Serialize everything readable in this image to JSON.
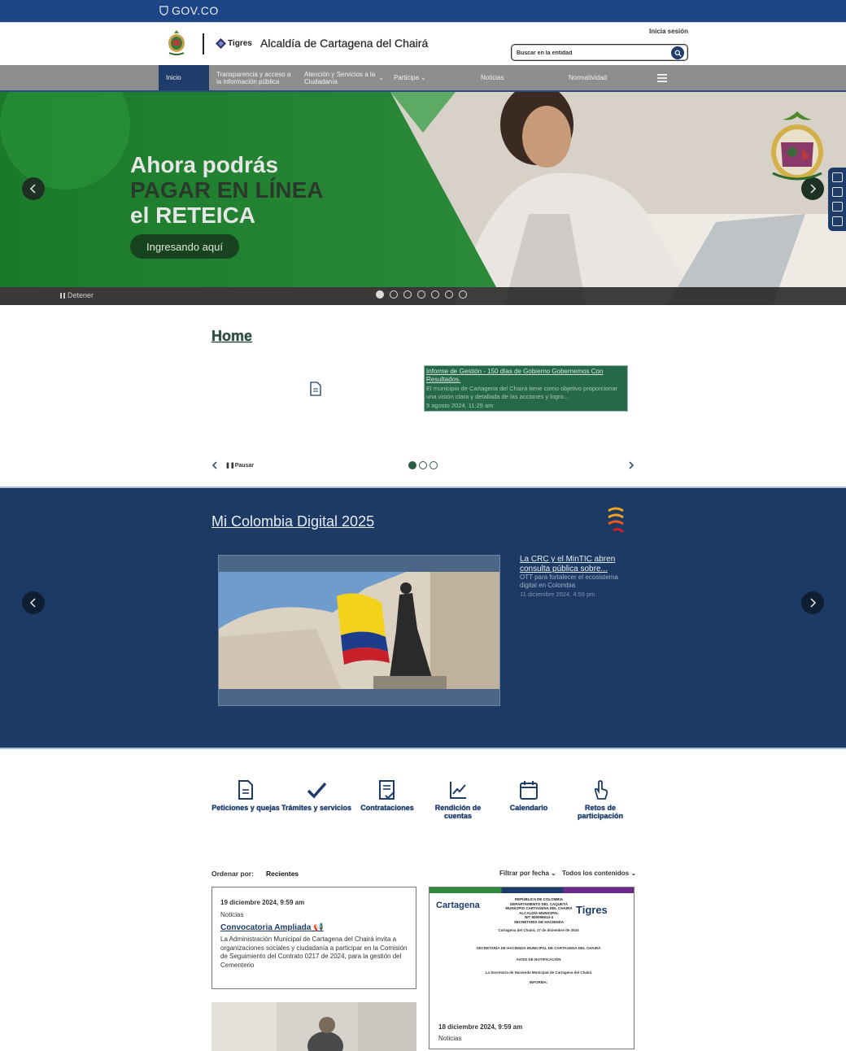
{
  "gov_bar": {
    "label": "GOV.CO"
  },
  "header": {
    "tigres_label": "Tigres",
    "site_name": "Alcaldía de Cartagena del Chairá",
    "login_label": "Inicia sesión",
    "search_placeholder": "Buscar en la entidad"
  },
  "nav": {
    "items": [
      {
        "label": "Inicio"
      },
      {
        "label": "Transparencia y acceso a la información pública"
      },
      {
        "label": "Atención y Servicios a la Ciudadanía"
      },
      {
        "label": "Participa"
      },
      {
        "label": "Noticias"
      },
      {
        "label": "Normatividad"
      }
    ]
  },
  "hero": {
    "line1": "Ahora podrás",
    "line2": "PAGAR EN LÍNEA",
    "line3": "el RETEICA",
    "cta_label": "Ingresando aquí",
    "stop_label": "Detener",
    "slide_count": 7,
    "active_slide": 1
  },
  "home": {
    "title": "Home",
    "news": {
      "title": "Informe de Gestión - 150 días de Gobierno Gobernemos Con Resultados.",
      "excerpt": "El municipio de Cartagena del Chairá tiene como objetivo proporcionar una visión clara y detallada de las acciones y logro...",
      "date": "9 agosto 2024, 11:29 am"
    },
    "pause_label": "Pausar",
    "slide_count": 3,
    "active_slide": 1
  },
  "digital": {
    "title": "Mi Colombia Digital 2025",
    "news_title": "La CRC y el MinTIC abren consulta pública sobre...",
    "news_excerpt": "OTT para fortalecer el ecosistema digital en Colombia",
    "news_date": "11 diciembre 2024, 4:59 pm"
  },
  "quick_links": [
    {
      "label": "Peticiones y quejas",
      "icon": "document-icon"
    },
    {
      "label": "Trámites y servicios",
      "icon": "check-icon"
    },
    {
      "label": "Contrataciones",
      "icon": "contract-icon"
    },
    {
      "label": "Rendición de cuentas",
      "icon": "chart-icon"
    },
    {
      "label": "Calendario",
      "icon": "calendar-icon"
    },
    {
      "label": "Retos de participación",
      "icon": "hand-icon"
    }
  ],
  "listing": {
    "sort_label": "Ordenar por:",
    "sort_value": "Recientes",
    "filter_date": "Filtrar por fecha",
    "filter_content": "Todos los contenidos"
  },
  "posts": [
    {
      "date": "19 diciembre 2024, 9:59 am",
      "category": "Noticias",
      "title": "Convocatoria Ampliada 📢",
      "excerpt": "La Administración Municipal de Cartagena del Chairá invita a organizaciones sociales y ciudadanía a participar en la Comisión de Seguimiento del Contrato 0217 de 2024, para la gestión del Cementerio"
    },
    {
      "date": "18 diciembre 2024, 9:59 am",
      "category": "Noticias",
      "logo_left": "Cartagena",
      "logo_right": "Tigres",
      "header_lines": [
        "REPÚBLICA DE COLOMBIA",
        "DEPARTAMENTO DEL CAQUETÁ",
        "MUNICIPIO CARTAGENA DEL CHAIRÁ",
        "ALCALDÍA MUNICIPAL",
        "NIT 800095613-4",
        "SECRETARÍA DE HACIENDA"
      ],
      "body_lines": [
        "Cartagena del Chairá, 17 de diciembre de 2024",
        "SECRETARÍA DE HACIENDA MUNICIPAL DE CARTAGENA DEL CHAIRÁ",
        "AVISO DE NOTIFICACIÓN",
        "La Secretaría de Hacienda Municipal de Cartagena del Chairá",
        "INFORMA:"
      ]
    }
  ],
  "colors": {
    "gov_blue": "#1d4484",
    "nav_gray": "#8e8e8e",
    "hero_green": "#1f7a2e",
    "digital_blue": "#1c3a64",
    "accent_navy": "#1d3c6a"
  }
}
